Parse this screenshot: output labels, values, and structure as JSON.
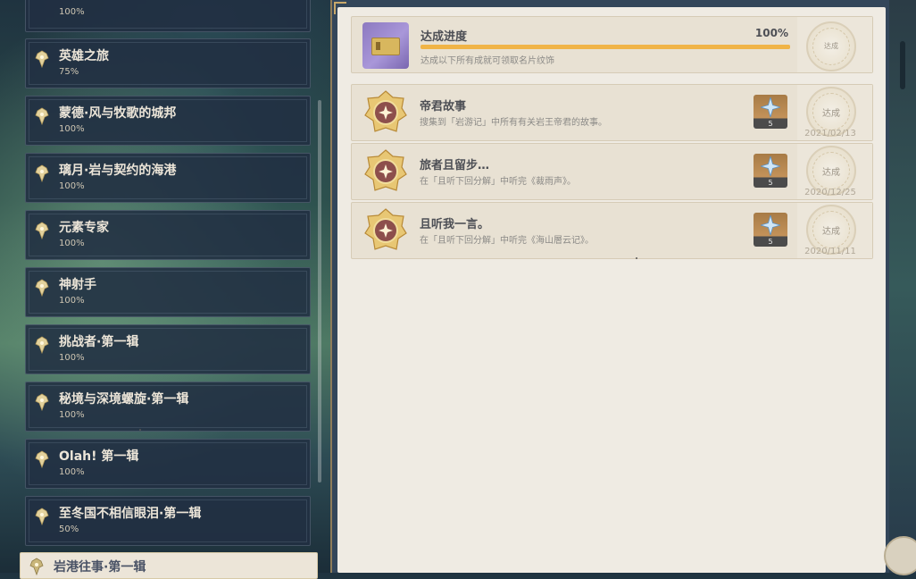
{
  "categories": [
    {
      "title": "",
      "percent": "100%"
    },
    {
      "title": "英雄之旅",
      "percent": "75%"
    },
    {
      "title": "蒙德·风与牧歌的城邦",
      "percent": "100%"
    },
    {
      "title": "璃月·岩与契约的海港",
      "percent": "100%"
    },
    {
      "title": "元素专家",
      "percent": "100%"
    },
    {
      "title": "神射手",
      "percent": "100%"
    },
    {
      "title": "挑战者·第一辑",
      "percent": "100%"
    },
    {
      "title": "秘境与深境螺旋·第一辑",
      "percent": "100%"
    },
    {
      "title": "Olah! 第一辑",
      "percent": "100%"
    },
    {
      "title": "至冬国不相信眼泪·第一辑",
      "percent": "50%"
    },
    {
      "title": "岩港往事·第一辑",
      "percent": ""
    }
  ],
  "progress": {
    "title": "达成进度",
    "percent_label": "100%",
    "fraction": 1.0,
    "description": "达成以下所有成就可领取名片纹饰",
    "seal_text": "达成"
  },
  "achievements": [
    {
      "title": "帝君故事",
      "description": "搜集到「岩游记」中所有有关岩王帝君的故事。",
      "reward_count": "5",
      "status": "达成",
      "date": "2021/02/13"
    },
    {
      "title": "旅者且留步…",
      "description": "在「且听下回分解」中听完《裁雨声》。",
      "reward_count": "5",
      "status": "达成",
      "date": "2020/12/25"
    },
    {
      "title": "且听我一言。",
      "description": "在「且听下回分解」中听完《海山層云记》。",
      "reward_count": "5",
      "status": "达成",
      "date": "2020/11/11"
    }
  ],
  "colors": {
    "accent_gold": "#f0b447",
    "panel_bg": "#efebe3",
    "list_item_bg": "#212f42"
  }
}
